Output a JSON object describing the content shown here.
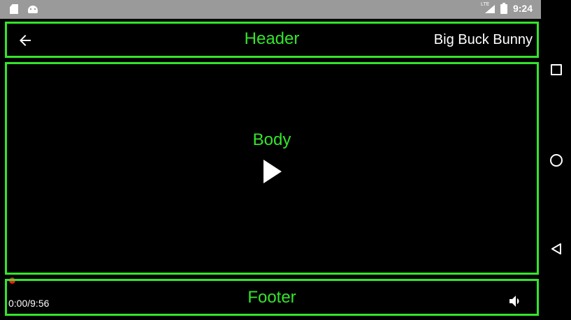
{
  "status_bar": {
    "network_label": "LTE",
    "time": "9:24"
  },
  "header": {
    "label": "Header",
    "title": "Big Buck Bunny"
  },
  "body": {
    "label": "Body",
    "play_icon": "play-icon"
  },
  "footer": {
    "label": "Footer",
    "elapsed": "0:00",
    "separator": "/",
    "duration": "9:56",
    "volume_icon": "volume-icon"
  },
  "colors": {
    "frame_green": "#33e52b",
    "seek_red": "#ff1a1a",
    "status_bar_bg": "#9a9a9a"
  }
}
